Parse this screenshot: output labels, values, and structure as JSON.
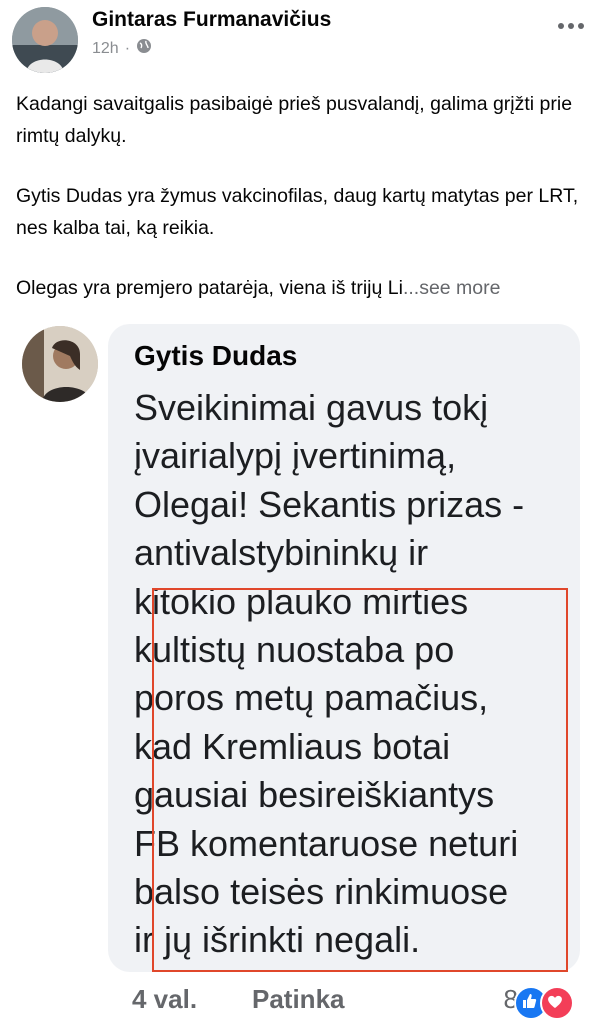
{
  "post": {
    "author": "Gintaras Furmanavičius",
    "time": "12h",
    "separator": "·",
    "paragraphs": [
      "Kadangi savaitgalis pasibaigė prieš pusvalandį, galima grįžti prie rimtų dalykų.",
      "Gytis Dudas yra žymus vakcinofilas, daug kartų matytas per LRT, nes kalba tai, ką reikia.",
      "Olegas yra premjero patarėja, viena iš trijų Li"
    ],
    "see_more": "...see more"
  },
  "comment": {
    "author": "Gytis Dudas",
    "lines": [
      "Sveikinimai gavus tokį",
      "įvairialypį įvertinimą,",
      "Olegai! Sekantis prizas -",
      "antivalstybininkų ir",
      "kitokio plauko mirties",
      "kultistų nuostaba po",
      "poros metų pamačius,",
      "kad Kremliaus botai",
      "gausiai besireiškiantys",
      "FB komentaruose neturi",
      "balso teisės rinkimuose",
      "ir jų išrinkti negali."
    ],
    "time": "4 val.",
    "like_label": "Patinka",
    "reaction_count": "8",
    "reaction_icons": [
      "like-icon",
      "love-icon"
    ]
  },
  "colors": {
    "highlight": "#e0472b",
    "like": "#1877f2",
    "love": "#f33e58",
    "bubble": "#f0f2f5"
  }
}
